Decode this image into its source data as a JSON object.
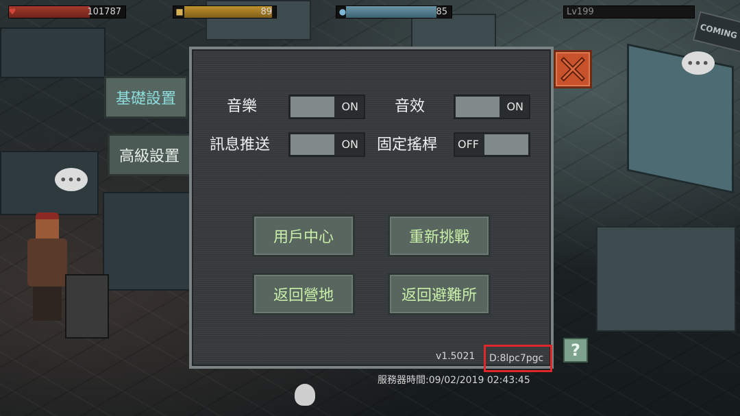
{
  "hud": {
    "hp": "101787",
    "food": "89",
    "water": "85",
    "level": "Lv199"
  },
  "tabs": {
    "basic": "基礎設置",
    "advanced": "高級設置"
  },
  "settings": {
    "music_label": "音樂",
    "music_state": "ON",
    "sfx_label": "音效",
    "sfx_state": "ON",
    "push_label": "訊息推送",
    "push_state": "ON",
    "joystick_label": "固定搖桿",
    "joystick_state": "OFF"
  },
  "buttons": {
    "user_center": "用戶中心",
    "rechallenge": "重新挑戰",
    "return_camp": "返回營地",
    "return_shelter": "返回避難所"
  },
  "footer": {
    "version": "v1.5021",
    "player_id": "D:8lpc7pgc",
    "server_time": "服務器時間:09/02/2019 02:43:45"
  },
  "help_glyph": "?",
  "colors": {
    "close": "#c7522c",
    "button_text": "#c8f0a8",
    "active_tab_text": "#8edede",
    "highlight_box": "#e0282a"
  },
  "icons": [
    "heart-icon",
    "food-icon",
    "water-drop-icon",
    "close-x-icon",
    "help-icon"
  ]
}
